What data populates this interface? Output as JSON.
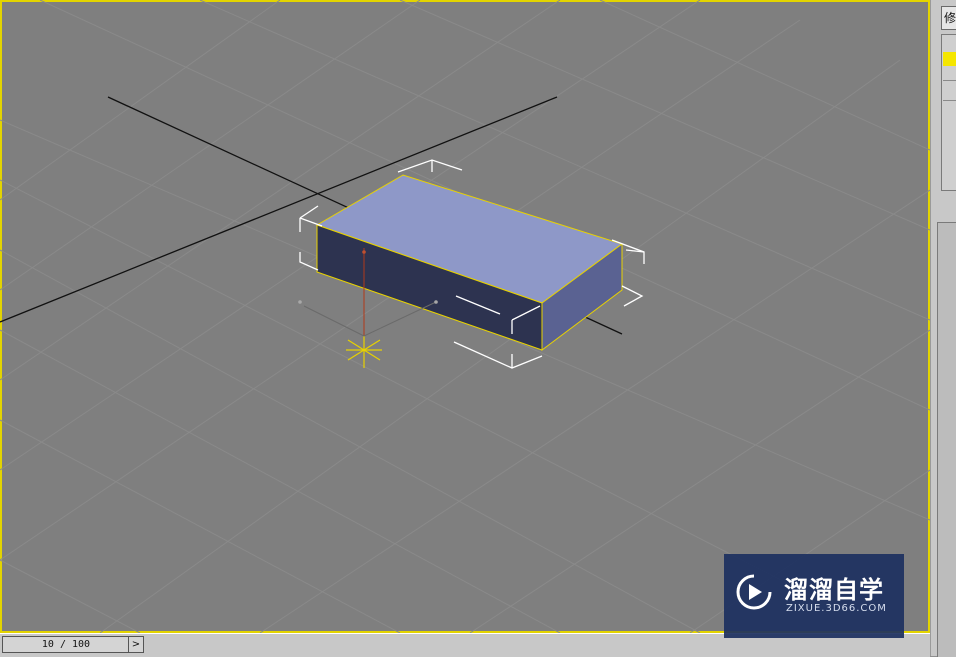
{
  "side_panel": {
    "tab_label": "修"
  },
  "timeline": {
    "frame_readout": "10 / 100",
    "next_symbol": ">"
  },
  "watermark": {
    "brand": "溜溜自学",
    "url": "ZIXUE.3D66.COM"
  },
  "colors": {
    "viewport_bg": "#7f7f7f",
    "grid": "#8c8c8c",
    "active_border": "#e3d400",
    "box_top": "#8e98c8",
    "box_front": "#2d3350",
    "box_side": "#5a6292",
    "selection_brackets": "#ffffff",
    "pivot_gizmo": "#e8d200",
    "watermark_bg": "#1c3060"
  },
  "icons": [
    "play-logo-icon",
    "next-frame-icon"
  ]
}
